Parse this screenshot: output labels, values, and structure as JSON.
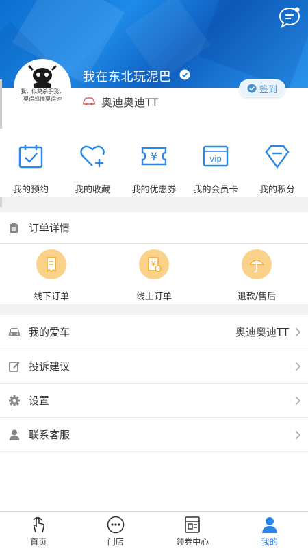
{
  "colors": {
    "primary": "#2a86e8",
    "accent_yellow": "#fbd28a",
    "header_blue": "#1e8ae8"
  },
  "profile": {
    "username": "我在东北玩泥巴",
    "avatar_text": "我，似鸽杀手我，莫得感情莫得钟",
    "car_name": "奥迪奥迪TT",
    "signin_label": "签到"
  },
  "quick_actions": [
    {
      "label": "我的预约",
      "icon": "calendar-check-icon"
    },
    {
      "label": "我的收藏",
      "icon": "heart-plus-icon"
    },
    {
      "label": "我的优惠券",
      "icon": "coupon-icon"
    },
    {
      "label": "我的会员卡",
      "icon": "vip-card-icon"
    },
    {
      "label": "我的积分",
      "icon": "diamond-icon"
    }
  ],
  "order": {
    "title": "订单详情",
    "items": [
      {
        "label": "线下订单",
        "icon": "receipt-icon"
      },
      {
        "label": "线上订单",
        "icon": "yen-receipt-icon"
      },
      {
        "label": "退款/售后",
        "icon": "umbrella-icon"
      }
    ]
  },
  "menu": [
    {
      "label": "我的爱车",
      "value": "奥迪奥迪TT",
      "icon": "car-icon"
    },
    {
      "label": "投诉建议",
      "value": "",
      "icon": "edit-icon"
    },
    {
      "label": "设置",
      "value": "",
      "icon": "gear-icon"
    },
    {
      "label": "联系客服",
      "value": "",
      "icon": "person-icon"
    }
  ],
  "tabs": [
    {
      "label": "首页",
      "icon": "hand-tap-icon"
    },
    {
      "label": "门店",
      "icon": "dots-circle-icon"
    },
    {
      "label": "领券中心",
      "icon": "ticket-icon"
    },
    {
      "label": "我的",
      "icon": "user-icon",
      "active": true
    }
  ]
}
